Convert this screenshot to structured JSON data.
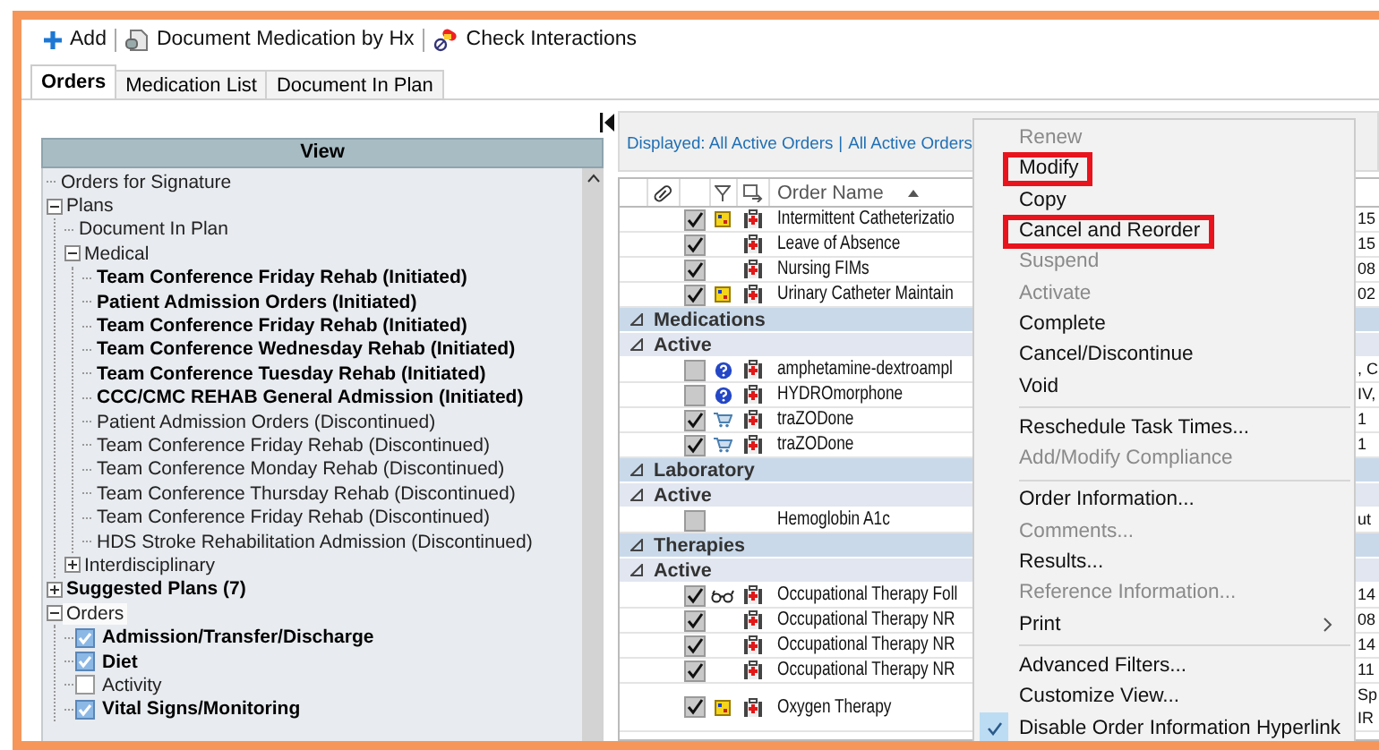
{
  "toolbar": [
    {
      "kind": "add",
      "label": "Add"
    },
    {
      "kind": "document",
      "label": "Document Medication by Hx"
    },
    {
      "kind": "interactions",
      "label": "Check Interactions"
    }
  ],
  "tabs": [
    {
      "label": "Orders",
      "selected": true
    },
    {
      "label": "Medication List",
      "selected": false
    },
    {
      "label": "Document In Plan",
      "selected": false
    }
  ],
  "view_panel": {
    "title": "View",
    "tree": [
      {
        "label": "Orders for Signature",
        "kind": "leaf",
        "bold": false,
        "selected": false
      },
      {
        "label": "Plans",
        "kind": "node",
        "expanded": true,
        "bold": false,
        "selected": false,
        "children": [
          {
            "label": "Document In Plan",
            "kind": "leaf",
            "bold": false,
            "selected": false
          },
          {
            "label": "Medical",
            "kind": "node",
            "expanded": true,
            "bold": false,
            "selected": false,
            "children": [
              {
                "label": "Team Conference Friday Rehab (Initiated)",
                "kind": "leaf",
                "bold": true,
                "selected": false
              },
              {
                "label": "Patient Admission Orders (Initiated)",
                "kind": "leaf",
                "bold": true,
                "selected": false
              },
              {
                "label": "Team Conference Friday Rehab (Initiated)",
                "kind": "leaf",
                "bold": true,
                "selected": false
              },
              {
                "label": "Team Conference Wednesday Rehab (Initiated)",
                "kind": "leaf",
                "bold": true,
                "selected": false
              },
              {
                "label": "Team Conference Tuesday Rehab (Initiated)",
                "kind": "leaf",
                "bold": true,
                "selected": false
              },
              {
                "label": "CCC/CMC REHAB General Admission (Initiated)",
                "kind": "leaf",
                "bold": true,
                "selected": false
              },
              {
                "label": "Patient Admission Orders (Discontinued)",
                "kind": "leaf",
                "bold": false,
                "selected": false
              },
              {
                "label": "Team Conference Friday Rehab (Discontinued)",
                "kind": "leaf",
                "bold": false,
                "selected": false
              },
              {
                "label": "Team Conference Monday Rehab (Discontinued)",
                "kind": "leaf",
                "bold": false,
                "selected": false
              },
              {
                "label": "Team Conference Thursday Rehab (Discontinued)",
                "kind": "leaf",
                "bold": false,
                "selected": false
              },
              {
                "label": "Team Conference Friday Rehab (Discontinued)",
                "kind": "leaf",
                "bold": false,
                "selected": false
              },
              {
                "label": "HDS Stroke Rehabilitation Admission (Discontinued)",
                "kind": "leaf",
                "bold": false,
                "selected": false
              }
            ]
          },
          {
            "label": "Interdisciplinary",
            "kind": "node",
            "expanded": false,
            "bold": false,
            "selected": false
          }
        ]
      },
      {
        "label": "Suggested Plans (7)",
        "kind": "node",
        "expanded": false,
        "bold": true,
        "selected": false
      },
      {
        "label": "Orders",
        "kind": "node",
        "expanded": true,
        "bold": false,
        "selected": true,
        "children": [
          {
            "label": "Admission/Transfer/Discharge",
            "kind": "check",
            "checked": true,
            "bold": true,
            "selected": false
          },
          {
            "label": "Diet",
            "kind": "check",
            "checked": true,
            "bold": true,
            "selected": false
          },
          {
            "label": "Activity",
            "kind": "check",
            "checked": false,
            "bold": false,
            "selected": false
          },
          {
            "label": "Vital Signs/Monitoring",
            "kind": "check",
            "checked": true,
            "bold": true,
            "selected": false
          }
        ]
      }
    ]
  },
  "orders_panel": {
    "filter_label": "Displayed: All Active Orders",
    "filter_separator": "|",
    "filter_link": "All Active Orders",
    "order_name_header": "Order Name",
    "rows": [
      {
        "kind": "order",
        "name": "Intermittent Catheterizatio",
        "checked": true,
        "indicator": {
          "kind": "plan"
        },
        "order_icon": true,
        "column_6": "15"
      },
      {
        "kind": "order",
        "name": "Leave of Absence",
        "checked": true,
        "order_icon": true,
        "column_6": "15"
      },
      {
        "kind": "order",
        "name": "Nursing FIMs",
        "checked": true,
        "order_icon": true,
        "column_6": "08"
      },
      {
        "kind": "order",
        "name": "Urinary Catheter Maintain",
        "checked": true,
        "indicator": {
          "kind": "plan"
        },
        "order_icon": true,
        "column_6": "02"
      },
      {
        "kind": "group",
        "label": "Medications",
        "expanded": true
      },
      {
        "kind": "subgroup",
        "label": "Active",
        "expanded": true
      },
      {
        "kind": "order",
        "name": "amphetamine-dextroampl",
        "checked": false,
        "indicator": {
          "kind": "info"
        },
        "order_icon": true,
        "column_6": ", C"
      },
      {
        "kind": "order",
        "name": "HYDROmorphone",
        "checked": false,
        "indicator": {
          "kind": "info"
        },
        "order_icon": true,
        "column_6": "IV,"
      },
      {
        "kind": "order",
        "name": "traZODone",
        "checked": true,
        "indicator": {
          "kind": "cart"
        },
        "order_icon": true,
        "column_6": "1"
      },
      {
        "kind": "order",
        "name": "traZODone",
        "checked": true,
        "indicator": {
          "kind": "cart"
        },
        "order_icon": true,
        "column_6": "1"
      },
      {
        "kind": "group",
        "label": "Laboratory",
        "expanded": true
      },
      {
        "kind": "subgroup",
        "label": "Active",
        "expanded": true
      },
      {
        "kind": "order",
        "name": "Hemoglobin A1c",
        "checked": false,
        "order_icon": false,
        "column_6": "ut"
      },
      {
        "kind": "group",
        "label": "Therapies",
        "expanded": true
      },
      {
        "kind": "subgroup",
        "label": "Active",
        "expanded": true
      },
      {
        "kind": "order",
        "name": "Occupational Therapy Foll",
        "checked": true,
        "indicator": {
          "kind": "glasses"
        },
        "order_icon": true,
        "column_6": "14"
      },
      {
        "kind": "order",
        "name": "Occupational Therapy NR",
        "checked": true,
        "order_icon": true,
        "column_6": "08"
      },
      {
        "kind": "order",
        "name": "Occupational Therapy NR",
        "checked": true,
        "order_icon": true,
        "column_6": "14"
      },
      {
        "kind": "order",
        "name": "Occupational Therapy NR",
        "checked": true,
        "order_icon": true,
        "column_6": "11"
      },
      {
        "kind": "order",
        "name": "Oxygen Therapy",
        "checked": true,
        "indicator": {
          "kind": "plan"
        },
        "order_icon": true,
        "column_6": "Sp\nIR"
      }
    ]
  },
  "context_menu": [
    {
      "kind": "item",
      "label": "Renew",
      "disabled": true,
      "highlighted": false,
      "checked": false,
      "submenu": false
    },
    {
      "kind": "item",
      "label": "Modify",
      "disabled": false,
      "highlighted": true,
      "checked": false,
      "submenu": false
    },
    {
      "kind": "item",
      "label": "Copy",
      "disabled": false,
      "highlighted": false,
      "checked": false,
      "submenu": false
    },
    {
      "kind": "item",
      "label": "Cancel and Reorder",
      "disabled": false,
      "highlighted": true,
      "checked": false,
      "submenu": false
    },
    {
      "kind": "item",
      "label": "Suspend",
      "disabled": true,
      "highlighted": false,
      "checked": false,
      "submenu": false
    },
    {
      "kind": "item",
      "label": "Activate",
      "disabled": true,
      "highlighted": false,
      "checked": false,
      "submenu": false
    },
    {
      "kind": "item",
      "label": "Complete",
      "disabled": false,
      "highlighted": false,
      "checked": false,
      "submenu": false
    },
    {
      "kind": "item",
      "label": "Cancel/Discontinue",
      "disabled": false,
      "highlighted": false,
      "checked": false,
      "submenu": false
    },
    {
      "kind": "item",
      "label": "Void",
      "disabled": false,
      "highlighted": false,
      "checked": false,
      "submenu": false
    },
    {
      "kind": "separator"
    },
    {
      "kind": "item",
      "label": "Reschedule Task Times...",
      "disabled": false,
      "highlighted": false,
      "checked": false,
      "submenu": false
    },
    {
      "kind": "item",
      "label": "Add/Modify Compliance",
      "disabled": true,
      "highlighted": false,
      "checked": false,
      "submenu": false
    },
    {
      "kind": "separator"
    },
    {
      "kind": "item",
      "label": "Order Information...",
      "disabled": false,
      "highlighted": false,
      "checked": false,
      "submenu": false
    },
    {
      "kind": "item",
      "label": "Comments...",
      "disabled": true,
      "highlighted": false,
      "checked": false,
      "submenu": false
    },
    {
      "kind": "item",
      "label": "Results...",
      "disabled": false,
      "highlighted": false,
      "checked": false,
      "submenu": false
    },
    {
      "kind": "item",
      "label": "Reference Information...",
      "disabled": true,
      "highlighted": false,
      "checked": false,
      "submenu": false
    },
    {
      "kind": "item",
      "label": "Print",
      "disabled": false,
      "highlighted": false,
      "checked": false,
      "submenu": true
    },
    {
      "kind": "separator"
    },
    {
      "kind": "item",
      "label": "Advanced Filters...",
      "disabled": false,
      "highlighted": false,
      "checked": false,
      "submenu": false
    },
    {
      "kind": "item",
      "label": "Customize View...",
      "disabled": false,
      "highlighted": false,
      "checked": false,
      "submenu": false
    },
    {
      "kind": "item",
      "label": "Disable Order Information Hyperlink",
      "disabled": false,
      "highlighted": false,
      "checked": true,
      "submenu": false
    }
  ]
}
